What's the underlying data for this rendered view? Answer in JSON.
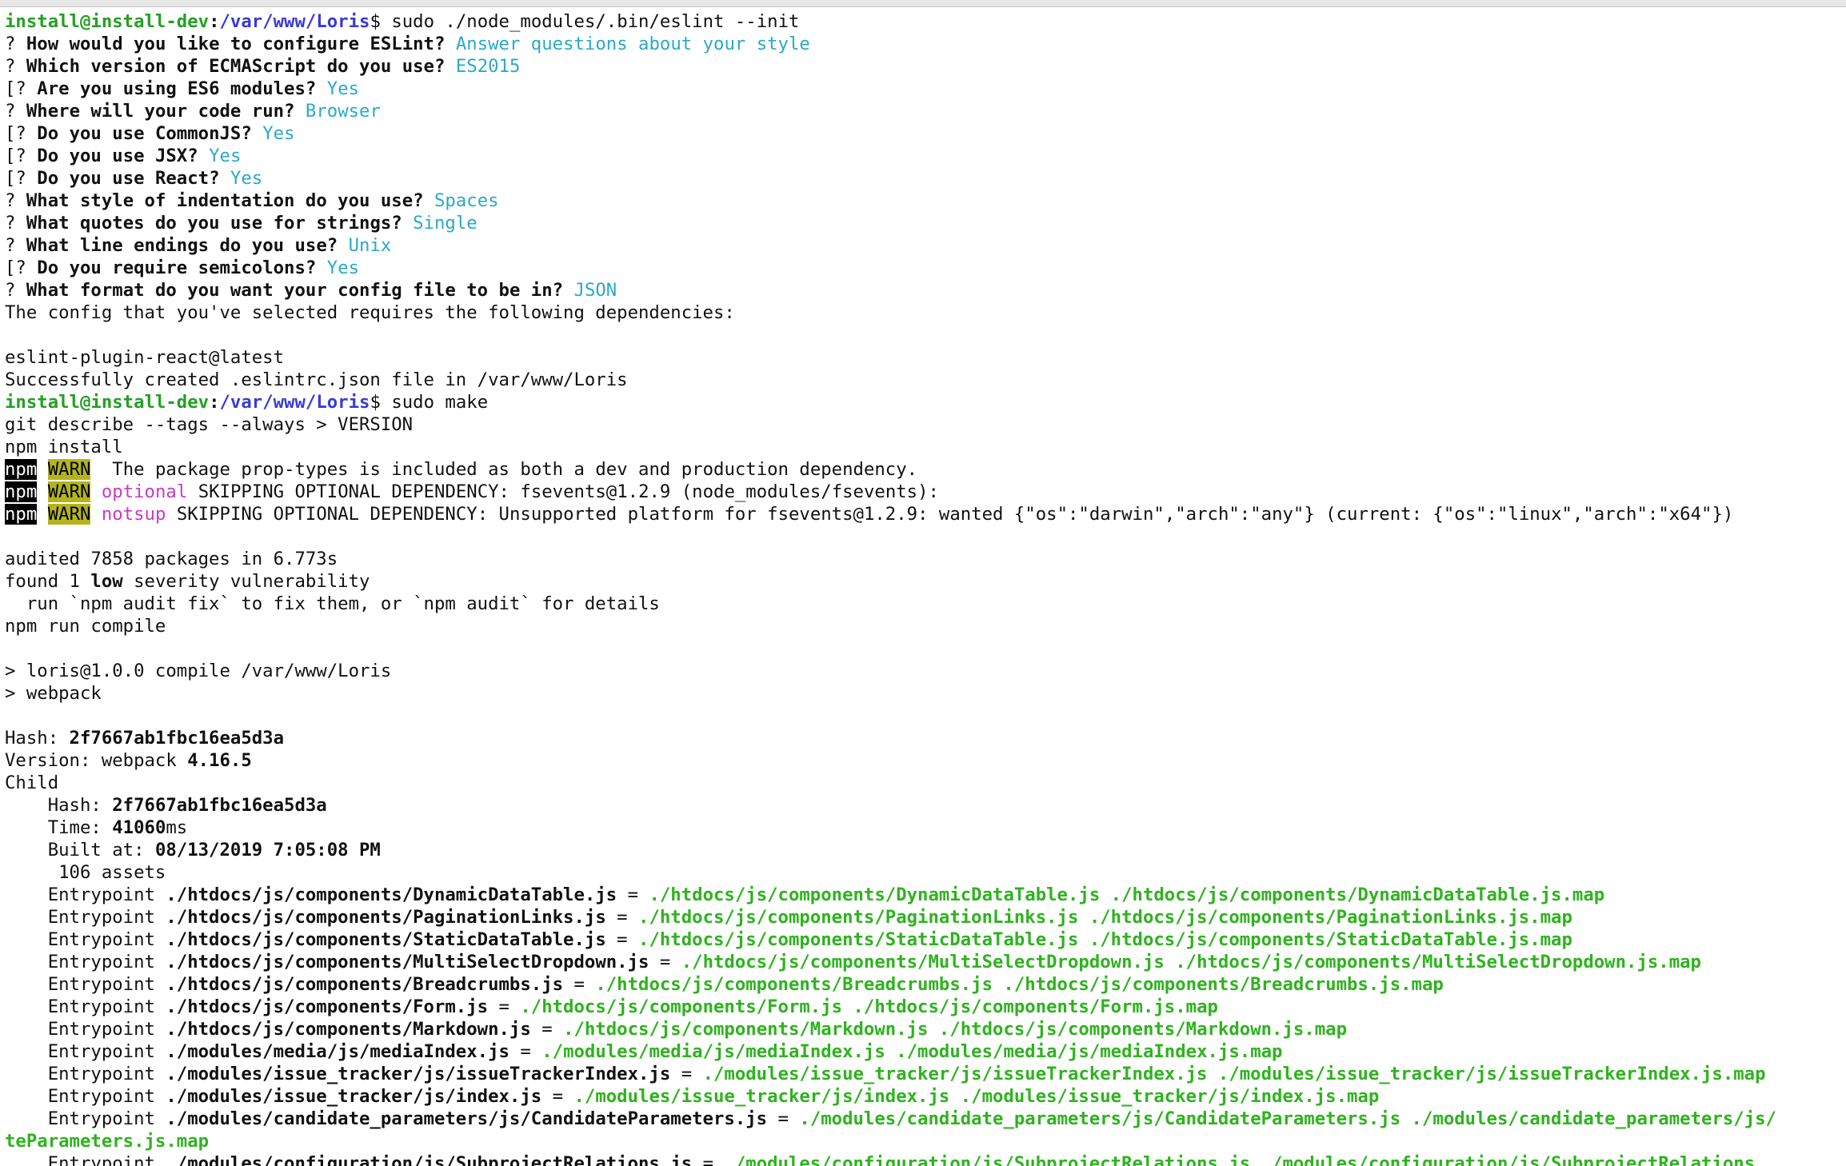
{
  "colors": {
    "background": "#ffffff",
    "text": "#111111",
    "prompt_user": "#23a023",
    "prompt_path": "#3a3ad6",
    "answer": "#2aa9c7",
    "asset_path": "#2eb31e",
    "warn_bg": "#b4b41e",
    "npm_bg": "#000000",
    "warn_label": "#c83ac8"
  },
  "prompt": {
    "user_host": "install@install-dev",
    "path": "/var/www/Loris",
    "symbol": "$"
  },
  "commands": {
    "eslint_init": "sudo ./node_modules/.bin/eslint --init",
    "make": "sudo make"
  },
  "eslint_questions": [
    {
      "marker": "?",
      "q": "How would you like to configure ESLint?",
      "a": "Answer questions about your style"
    },
    {
      "marker": "?",
      "q": "Which version of ECMAScript do you use?",
      "a": "ES2015"
    },
    {
      "marker": "[?",
      "q": "Are you using ES6 modules?",
      "a": "Yes"
    },
    {
      "marker": "?",
      "q": "Where will your code run?",
      "a": "Browser"
    },
    {
      "marker": "[?",
      "q": "Do you use CommonJS?",
      "a": "Yes"
    },
    {
      "marker": "[?",
      "q": "Do you use JSX?",
      "a": "Yes"
    },
    {
      "marker": "[?",
      "q": "Do you use React?",
      "a": "Yes"
    },
    {
      "marker": "?",
      "q": "What style of indentation do you use?",
      "a": "Spaces"
    },
    {
      "marker": "?",
      "q": "What quotes do you use for strings?",
      "a": "Single"
    },
    {
      "marker": "?",
      "q": "What line endings do you use?",
      "a": "Unix"
    },
    {
      "marker": "[?",
      "q": "Do you require semicolons?",
      "a": "Yes"
    },
    {
      "marker": "?",
      "q": "What format do you want your config file to be in?",
      "a": "JSON"
    }
  ],
  "eslint_output": {
    "deps_notice": "The config that you've selected requires the following dependencies:",
    "dependency": "eslint-plugin-react@latest",
    "created": "Successfully created .eslintrc.json file in /var/www/Loris"
  },
  "make_output": {
    "git_describe": "git describe --tags --always > VERSION",
    "npm_install": "npm install",
    "warnings": [
      {
        "npm": "npm",
        "warn": "WARN",
        "tag": "",
        "text": " The package prop-types is included as both a dev and production dependency."
      },
      {
        "npm": "npm",
        "warn": "WARN",
        "tag": "optional",
        "text": " SKIPPING OPTIONAL DEPENDENCY: fsevents@1.2.9 (node_modules/fsevents):"
      },
      {
        "npm": "npm",
        "warn": "WARN",
        "tag": "notsup",
        "text": " SKIPPING OPTIONAL DEPENDENCY: Unsupported platform for fsevents@1.2.9: wanted {\"os\":\"darwin\",\"arch\":\"any\"} (current: {\"os\":\"linux\",\"arch\":\"x64\"})"
      }
    ],
    "audited": "audited 7858 packages in 6.773s",
    "found_prefix": "found 1 ",
    "found_bold": "low",
    "found_suffix": " severity vulnerability",
    "audit_hint": "  run `npm audit fix` to fix them, or `npm audit` for details",
    "npm_run_compile": "npm run compile",
    "compile_line": "> loris@1.0.0 compile /var/www/Loris",
    "webpack_line": "> webpack"
  },
  "webpack_stats": {
    "hash_label": "Hash: ",
    "hash": "2f7667ab1fbc16ea5d3a",
    "version_label": "Version: webpack ",
    "version": "4.16.5",
    "child": "Child",
    "child_hash_label": "    Hash: ",
    "child_hash": "2f7667ab1fbc16ea5d3a",
    "time_label": "    Time: ",
    "time_value": "41060",
    "time_unit": "ms",
    "built_label": "    Built at: ",
    "built_value": "08/13/2019 7:05:08 PM",
    "assets": "     106 assets"
  },
  "entrypoints": [
    {
      "name": "./htdocs/js/components/DynamicDataTable.js",
      "files": "./htdocs/js/components/DynamicDataTable.js ./htdocs/js/components/DynamicDataTable.js.map"
    },
    {
      "name": "./htdocs/js/components/PaginationLinks.js",
      "files": "./htdocs/js/components/PaginationLinks.js ./htdocs/js/components/PaginationLinks.js.map"
    },
    {
      "name": "./htdocs/js/components/StaticDataTable.js",
      "files": "./htdocs/js/components/StaticDataTable.js ./htdocs/js/components/StaticDataTable.js.map"
    },
    {
      "name": "./htdocs/js/components/MultiSelectDropdown.js",
      "files": "./htdocs/js/components/MultiSelectDropdown.js ./htdocs/js/components/MultiSelectDropdown.js.map"
    },
    {
      "name": "./htdocs/js/components/Breadcrumbs.js",
      "files": "./htdocs/js/components/Breadcrumbs.js ./htdocs/js/components/Breadcrumbs.js.map"
    },
    {
      "name": "./htdocs/js/components/Form.js",
      "files": "./htdocs/js/components/Form.js ./htdocs/js/components/Form.js.map"
    },
    {
      "name": "./htdocs/js/components/Markdown.js",
      "files": "./htdocs/js/components/Markdown.js ./htdocs/js/components/Markdown.js.map"
    },
    {
      "name": "./modules/media/js/mediaIndex.js",
      "files": "./modules/media/js/mediaIndex.js ./modules/media/js/mediaIndex.js.map"
    },
    {
      "name": "./modules/issue_tracker/js/issueTrackerIndex.js",
      "files": "./modules/issue_tracker/js/issueTrackerIndex.js ./modules/issue_tracker/js/issueTrackerIndex.js.map"
    },
    {
      "name": "./modules/issue_tracker/js/index.js",
      "files": "./modules/issue_tracker/js/index.js ./modules/issue_tracker/js/index.js.map"
    },
    {
      "name": "./modules/candidate_parameters/js/CandidateParameters.js",
      "files": "./modules/candidate_parameters/js/CandidateParameters.js ./modules/candidate_parameters/js/"
    },
    {
      "name": "./modules/configuration/js/SubprojectRelations.js",
      "files": "./modules/configuration/js/SubprojectRelations.js ./modules/configuration/js/SubprojectRelations"
    }
  ],
  "entrypoint_label": "    Entrypoint ",
  "entrypoint_sep": " = ",
  "wrap_tail": "teParameters.js.map"
}
